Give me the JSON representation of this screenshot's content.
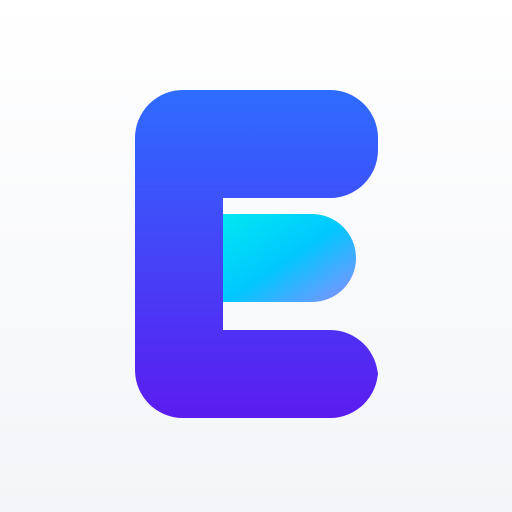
{
  "logo": {
    "icon": "letter-e-logo-icon",
    "colors": {
      "body_top": "#2E6CFF",
      "body_bottom": "#5B1CF0",
      "accent_start": "#00E8F2",
      "accent_mid": "#00C8FF",
      "accent_end": "#8B8CFF",
      "background_top": "#FFFFFF",
      "background_bottom": "#F3F5F8"
    }
  }
}
